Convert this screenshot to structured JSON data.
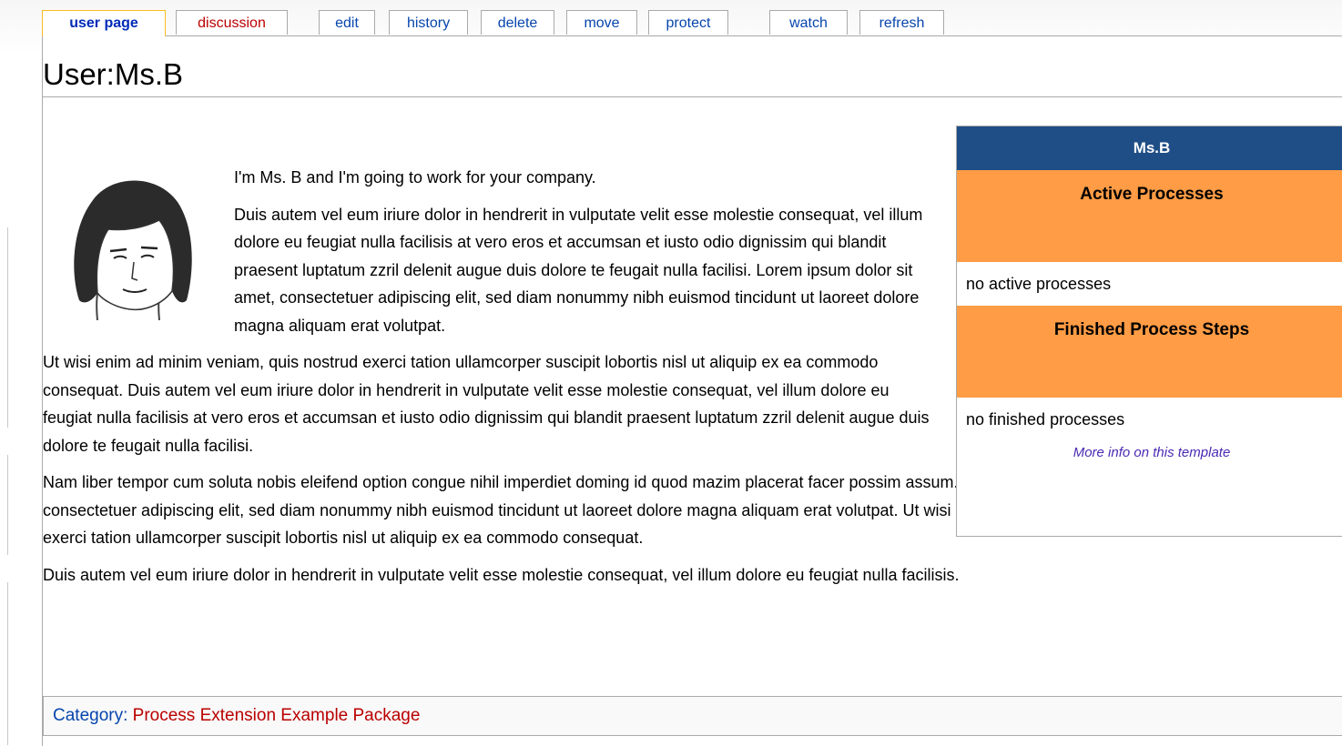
{
  "tabs": [
    {
      "label": "user page"
    },
    {
      "label": "discussion"
    },
    {
      "label": "edit"
    },
    {
      "label": "history"
    },
    {
      "label": "delete"
    },
    {
      "label": "move"
    },
    {
      "label": "protect"
    },
    {
      "label": "watch"
    },
    {
      "label": "refresh"
    }
  ],
  "page": {
    "title": "User:Ms.B"
  },
  "body": {
    "p1": "I'm Ms. B and I'm going to work for your company.",
    "p2": "Duis autem vel eum iriure dolor in hendrerit in vulputate velit esse molestie consequat, vel illum dolore eu feugiat nulla facilisis at vero eros et accumsan et iusto odio dignissim qui blandit praesent luptatum zzril delenit augue duis dolore te feugait nulla facilisi. Lorem ipsum dolor sit amet, consectetuer adipiscing elit, sed diam nonummy nibh euismod tincidunt ut laoreet dolore magna aliquam erat volutpat.",
    "p3": "Ut wisi enim ad minim veniam, quis nostrud exerci tation ullamcorper suscipit lobortis nisl ut aliquip ex ea commodo consequat. Duis autem vel eum iriure dolor in hendrerit in vulputate velit esse molestie consequat, vel illum dolore eu feugiat nulla facilisis at vero eros et accumsan et iusto odio dignissim qui blandit praesent luptatum zzril delenit augue duis dolore te feugait nulla facilisi.",
    "p4": "Nam liber tempor cum soluta nobis eleifend option congue nihil imperdiet doming id quod mazim placerat facer possim assum. Lorem ipsum dolor sit amet, consectetuer adipiscing elit, sed diam nonummy nibh euismod tincidunt ut laoreet dolore magna aliquam erat volutpat. Ut wisi enim ad minim veniam, quis nostrud exerci tation ullamcorper suscipit lobortis nisl ut aliquip ex ea commodo consequat.",
    "p5": "Duis autem vel eum iriure dolor in hendrerit in vulputate velit esse molestie consequat, vel illum dolore eu feugiat nulla facilisis."
  },
  "infobox": {
    "name": "Ms.B",
    "active_heading": "Active Processes",
    "active_value": "no active processes",
    "finished_heading": "Finished Process Steps",
    "finished_value": "no finished processes",
    "more_info": "More info on this template"
  },
  "categories": {
    "label": "Category",
    "link": "Process Extension Example Package"
  },
  "colors": {
    "infobox_header": "#1f4e86",
    "infobox_section": "#ff9c45",
    "link_blue": "#0645ad",
    "link_red": "#ba0000"
  }
}
